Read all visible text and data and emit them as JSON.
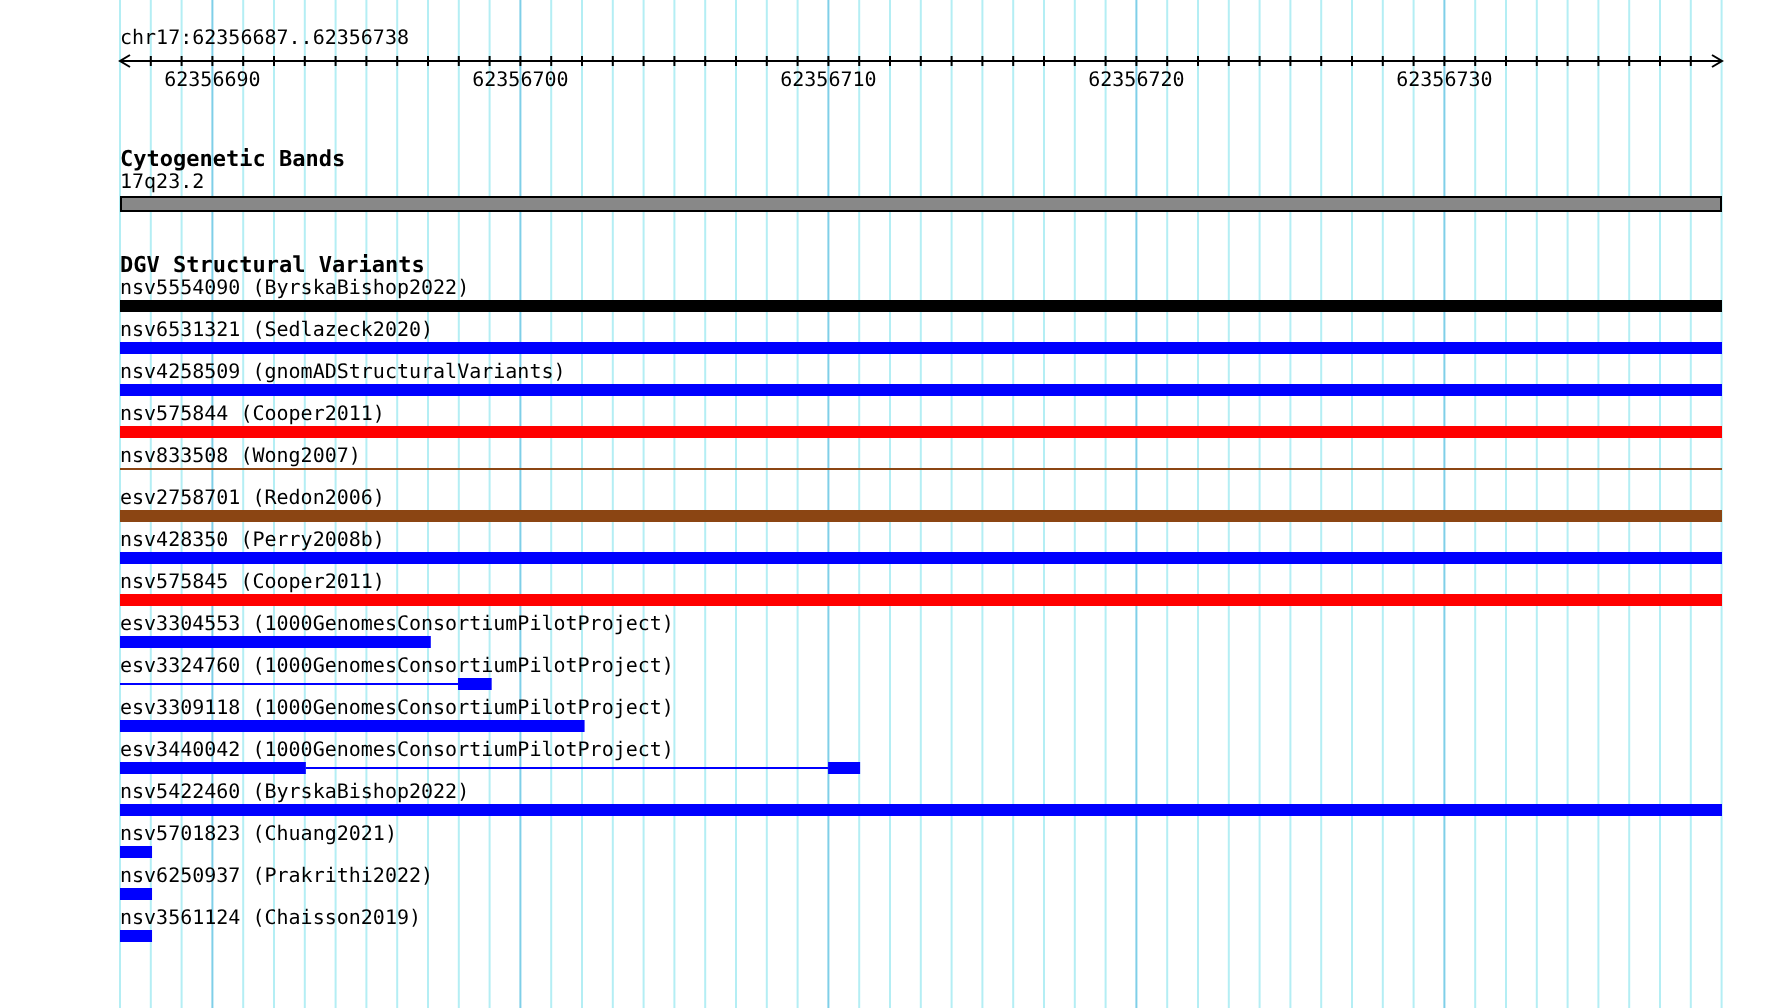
{
  "position": "chr17:62356687..62356738",
  "ruler": {
    "ticks": [
      "62356690",
      "62356700",
      "62356710",
      "62356720",
      "62356730"
    ]
  },
  "tracks": [
    {
      "kind": "cytoband",
      "title": "Cytogenetic Bands",
      "items": [
        {
          "label": "17q23.2",
          "color": "#888888"
        }
      ]
    },
    {
      "kind": "variants",
      "title": "DGV Structural Variants",
      "items": [
        {
          "label": "nsv5554090 (ByrskaBishop2022)",
          "color": "#000000",
          "kind": "bar"
        },
        {
          "label": "nsv6531321 (Sedlazeck2020)",
          "color": "#0000ff",
          "kind": "bar"
        },
        {
          "label": "nsv4258509 (gnomADStructuralVariants)",
          "color": "#0000ff",
          "kind": "bar"
        },
        {
          "label": "nsv575844 (Cooper2011)",
          "color": "#ff0000",
          "kind": "bar"
        },
        {
          "label": "nsv833508 (Wong2007)",
          "color": "#8b4513",
          "kind": "line"
        },
        {
          "label": "esv2758701 (Redon2006)",
          "color": "#8b4513",
          "kind": "bar"
        },
        {
          "label": "nsv428350 (Perry2008b)",
          "color": "#0000ff",
          "kind": "bar"
        },
        {
          "label": "nsv575845 (Cooper2011)",
          "color": "#ff0000",
          "kind": "bar"
        },
        {
          "label": "esv3304553 (1000GenomesConsortiumPilotProject)",
          "color": "#0000ff",
          "kind": "bar"
        },
        {
          "label": "esv3324760 (1000GenomesConsortiumPilotProject)",
          "color": "#0000ff",
          "kind": "gapped"
        },
        {
          "label": "esv3309118 (1000GenomesConsortiumPilotProject)",
          "color": "#0000ff",
          "kind": "bar"
        },
        {
          "label": "esv3440042 (1000GenomesConsortiumPilotProject)",
          "color": "#0000ff",
          "kind": "gapped"
        },
        {
          "label": "nsv5422460 (ByrskaBishop2022)",
          "color": "#0000ff",
          "kind": "bar"
        },
        {
          "label": "nsv5701823 (Chuang2021)",
          "color": "#0000ff",
          "kind": "bar"
        },
        {
          "label": "nsv6250937 (Prakrithi2022)",
          "color": "#0000ff",
          "kind": "bar"
        },
        {
          "label": "nsv3561124 (Chaisson2019)",
          "color": "#0000ff",
          "kind": "bar"
        }
      ]
    }
  ]
}
